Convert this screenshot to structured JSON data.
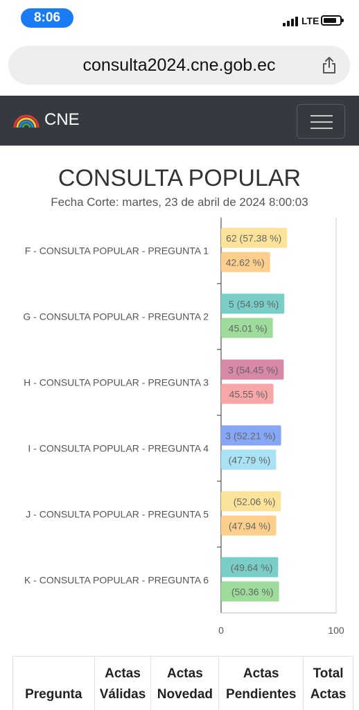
{
  "status_bar": {
    "time": "8:06",
    "network": "LTE"
  },
  "browser": {
    "url": "consulta2024.cne.gob.ec",
    "share_icon": "share-icon"
  },
  "navbar": {
    "brand": "CNE",
    "logo_icon": "cne-rainbow-logo",
    "menu_icon": "hamburger-icon"
  },
  "header": {
    "title": "CONSULTA POPULAR",
    "subtitle": "Fecha Corte: martes, 23 de abril de 2024 8:00:03"
  },
  "chart_data": {
    "type": "bar",
    "orientation": "horizontal",
    "categories": [
      "F - CONSULTA POPULAR - PREGUNTA 1",
      "G - CONSULTA POPULAR - PREGUNTA 2",
      "H - CONSULTA POPULAR - PREGUNTA 3",
      "I - CONSULTA POPULAR - PREGUNTA 4",
      "J - CONSULTA POPULAR - PREGUNTA 5",
      "K - CONSULTA POPULAR - PREGUNTA 6"
    ],
    "bars": [
      [
        {
          "value": 57.38,
          "label": "62 (57.38 %)",
          "color": "#fbe49a"
        },
        {
          "value": 42.62,
          "label": "42.62 %)",
          "color": "#fcd08c"
        }
      ],
      [
        {
          "value": 54.99,
          "label": "5 (54.99 %)",
          "color": "#79cfc7"
        },
        {
          "value": 45.01,
          "label": "45.01 %)",
          "color": "#9ddc9a"
        }
      ],
      [
        {
          "value": 54.45,
          "label": "3 (54.45 %)",
          "color": "#d987a6"
        },
        {
          "value": 45.55,
          "label": "45.55 %)",
          "color": "#f8a6a7"
        }
      ],
      [
        {
          "value": 52.21,
          "label": "3 (52.21 %)",
          "color": "#86a7f6"
        },
        {
          "value": 47.79,
          "label": "(47.79 %)",
          "color": "#a9e2f5"
        }
      ],
      [
        {
          "value": 52.06,
          "label": "(52.06 %)",
          "color": "#fbe49a"
        },
        {
          "value": 47.94,
          "label": "(47.94 %)",
          "color": "#fcd08c"
        }
      ],
      [
        {
          "value": 49.64,
          "label": "(49.64 %)",
          "color": "#79cfc7"
        },
        {
          "value": 50.36,
          "label": "(50.36 %)",
          "color": "#9ddc9a"
        }
      ]
    ],
    "xlim": [
      0,
      100
    ],
    "x_ticks": [
      "0",
      "100"
    ],
    "grid": false,
    "legend": "none"
  },
  "table": {
    "headers": [
      [
        "Pregunta"
      ],
      [
        "Actas",
        "Válidas"
      ],
      [
        "Actas",
        "Novedad"
      ],
      [
        "Actas",
        "Pendientes"
      ],
      [
        "Total",
        "Actas"
      ]
    ]
  }
}
